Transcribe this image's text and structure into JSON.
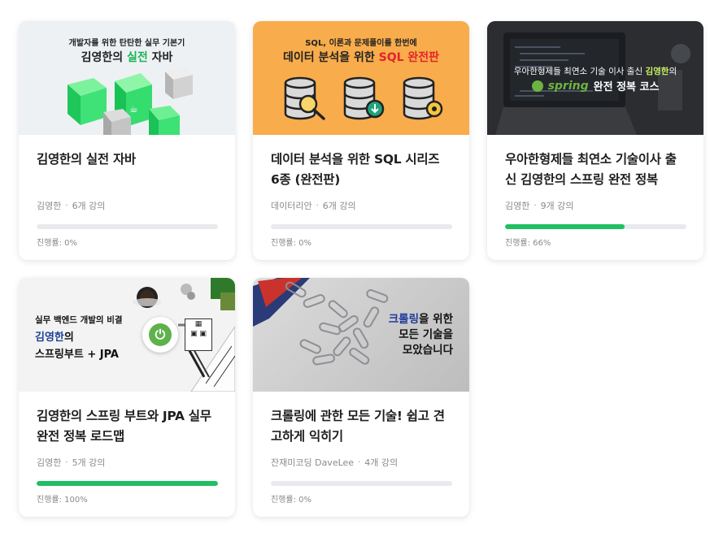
{
  "courses": [
    {
      "thumb_line1": "개발자를 위한 탄탄한 실무 기본기",
      "thumb_line2a": "김영한의 ",
      "thumb_line2b": "실전",
      "thumb_line2c": " 자바",
      "title": "김영한의 실전 자바",
      "author": "김영한",
      "count": "6개 강의",
      "progress": 0,
      "progress_label": "진행률: 0%"
    },
    {
      "thumb_line1": "SQL, 이론과 문제풀이를 한번에",
      "thumb_line2a": "데이터 분석을 위한 ",
      "thumb_line2b": "SQL 완전판",
      "title": "데이터 분석을 위한 SQL 시리즈 6종 (완전판)",
      "author": "데이터리안",
      "count": "6개 강의",
      "progress": 0,
      "progress_label": "진행률: 0%"
    },
    {
      "thumb_line1a": "우아한형제들 최연소 기술 이사 출신 ",
      "thumb_line1b": "김영한",
      "thumb_line1c": "의",
      "thumb_spring": "spring",
      "thumb_line2": "완전 정복 코스",
      "title": "우아한형제들 최연소 기술이사 출신 김영한의 스프링 완전 정복",
      "author": "김영한",
      "count": "9개 강의",
      "progress": 66,
      "progress_label": "진행률: 66%"
    },
    {
      "thumb_line1": "실무 백엔드 개발의 비결",
      "thumb_line2": "김영한",
      "thumb_line2b": "의",
      "thumb_line3": "스프링부트 + JPA",
      "title": "김영한의 스프링 부트와 JPA 실무 완전 정복 로드맵",
      "author": "김영한",
      "count": "5개 강의",
      "progress": 100,
      "progress_label": "진행률: 100%"
    },
    {
      "thumb_line1a": "크롤링",
      "thumb_line1b": "을 위한",
      "thumb_line2": "모든 기술을",
      "thumb_line3": "모았습니다",
      "title": "크롤링에 관한 모든 기술! 쉽고 견고하게 익히기",
      "author": "잔재미코딩 DaveLee",
      "count": "4개 강의",
      "progress": 0,
      "progress_label": "진행률: 0%"
    }
  ],
  "colors": {
    "progress_fill": "#1fbf62",
    "progress_track": "#e8eaed",
    "sql_orange": "#f8ac4b"
  }
}
